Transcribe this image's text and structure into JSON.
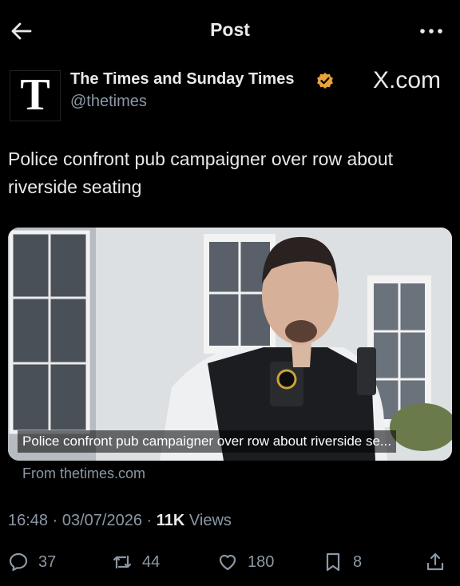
{
  "header": {
    "title": "Post"
  },
  "author": {
    "logo_letter": "T",
    "name": "The Times and Sunday Times",
    "handle": "@thetimes",
    "site": "X.com"
  },
  "post": {
    "text": "Police confront pub campaigner over row about riverside seating",
    "media_caption": "Police confront pub campaigner over row about riverside se...",
    "source": "From thetimes.com",
    "time": "16:48",
    "date": "03/07/2026",
    "sep": "·",
    "views_count": "11K",
    "views_label": "Views"
  },
  "actions": {
    "replies": "37",
    "reposts": "44",
    "likes": "180",
    "bookmarks": "8"
  },
  "colors": {
    "background": "#000000",
    "text": "#e7e9ea",
    "muted": "#8b98a5",
    "verified": "#e8a33c"
  },
  "icons": [
    "back-arrow-icon",
    "more-icon",
    "verified-icon",
    "reply-icon",
    "repost-icon",
    "like-icon",
    "bookmark-icon",
    "share-icon"
  ]
}
